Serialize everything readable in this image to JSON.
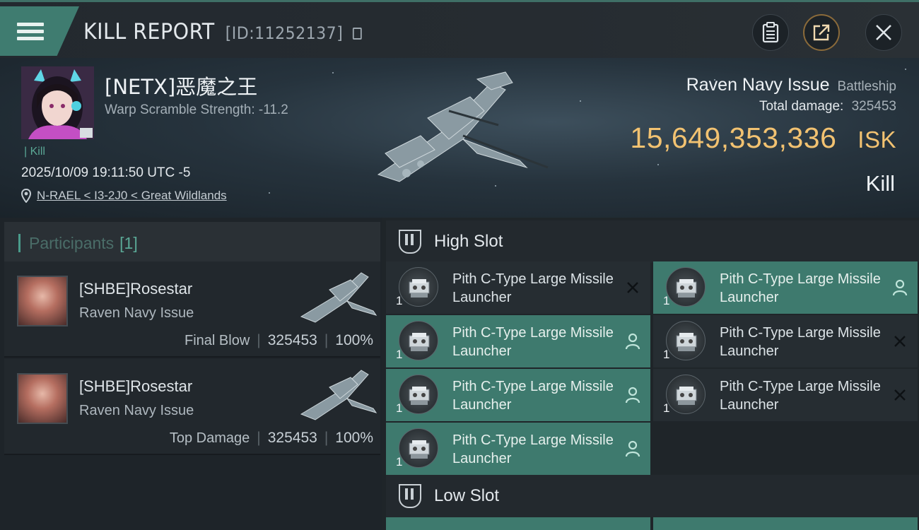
{
  "topbar": {
    "title": "KILL REPORT",
    "report_id": "[ID:11252137]",
    "buttons": [
      {
        "name": "clipboard-button",
        "icon": "clipboard-icon"
      },
      {
        "name": "share-button",
        "icon": "share-icon"
      },
      {
        "name": "close-button",
        "icon": "close-icon"
      }
    ]
  },
  "victim": {
    "name": "[NETX]恶魔之王",
    "warp_scramble": "Warp Scramble Strength: -11.2",
    "tag": "Kill",
    "datetime": "2025/10/09 19:11:50 UTC -5",
    "location": "N-RAEL < I3-2J0 < Great Wildlands",
    "ship": "Raven Navy Issue",
    "ship_class": "Battleship",
    "total_damage_label": "Total damage:",
    "total_damage": "325453",
    "isk_value": "15,649,353,336",
    "isk_unit": "ISK",
    "outcome": "Kill"
  },
  "participants": {
    "label": "Participants",
    "count": "[1]",
    "rows": [
      {
        "name": "[SHBE]Rosestar",
        "ship": "Raven Navy Issue",
        "tag": "Final Blow",
        "damage": "325453",
        "percent": "100%"
      },
      {
        "name": "[SHBE]Rosestar",
        "ship": "Raven Navy Issue",
        "tag": "Top Damage",
        "damage": "325453",
        "percent": "100%"
      }
    ]
  },
  "slots": {
    "high_label": "High Slot",
    "low_label": "Low Slot",
    "high_modules": [
      {
        "name": "Pith C-Type Large Missile Launcher",
        "qty": "1",
        "status": "destroyed",
        "active": false
      },
      {
        "name": "Pith C-Type Large Missile Launcher",
        "qty": "1",
        "status": "dropped",
        "active": true
      },
      {
        "name": "Pith C-Type Large Missile Launcher",
        "qty": "1",
        "status": "dropped",
        "active": true
      },
      {
        "name": "Pith C-Type Large Missile Launcher",
        "qty": "1",
        "status": "destroyed",
        "active": false
      },
      {
        "name": "Pith C-Type Large Missile Launcher",
        "qty": "1",
        "status": "dropped",
        "active": true
      },
      {
        "name": "Pith C-Type Large Missile Launcher",
        "qty": "1",
        "status": "destroyed",
        "active": false
      },
      {
        "name": "Pith C-Type Large Missile Launcher",
        "qty": "1",
        "status": "dropped",
        "active": true
      }
    ]
  },
  "colors": {
    "accent": "#3e7a6e",
    "isk": "#f2c271",
    "background": "#1a2026"
  }
}
